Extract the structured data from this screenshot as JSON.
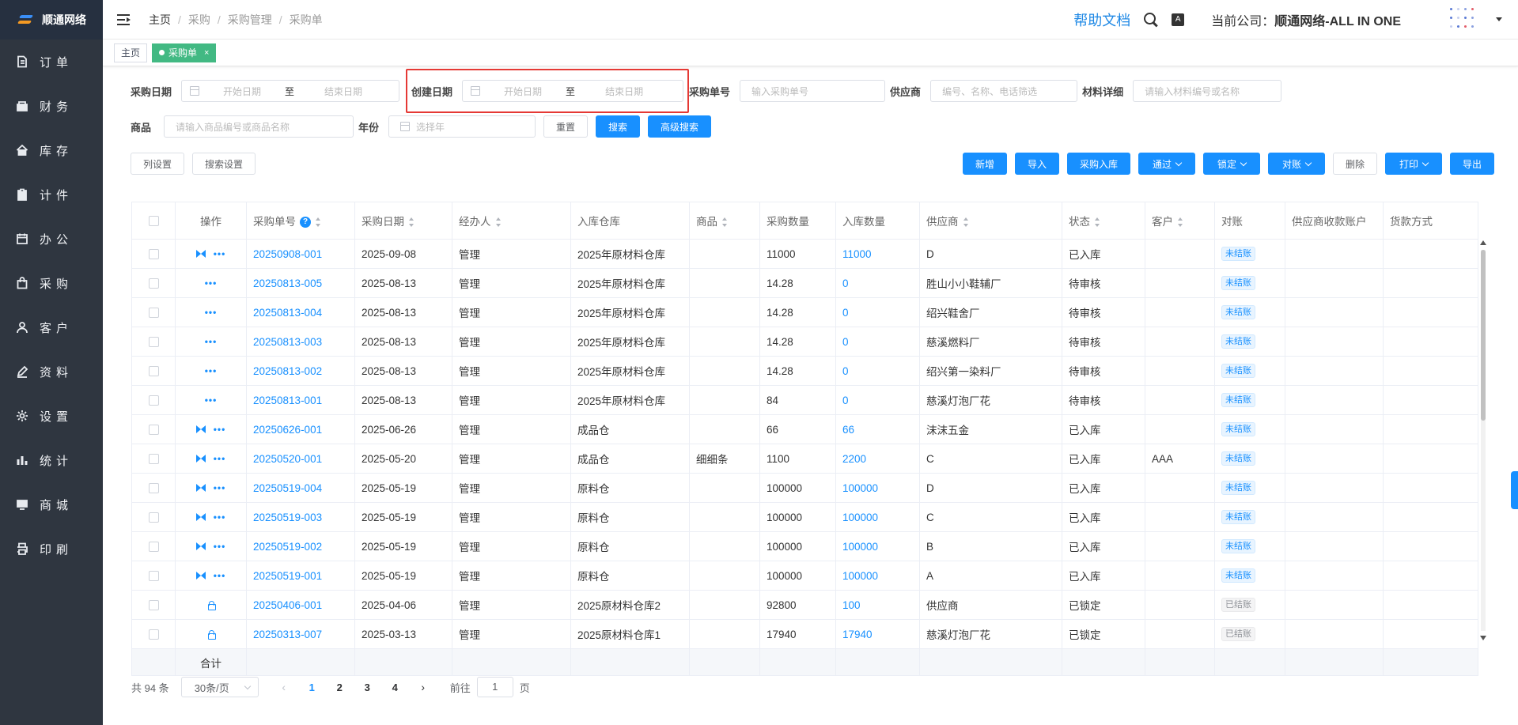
{
  "brand": {
    "name": "顺通网络"
  },
  "sidebar": {
    "items": [
      {
        "label": "订单",
        "icon": "order-icon"
      },
      {
        "label": "财务",
        "icon": "wallet-icon"
      },
      {
        "label": "库存",
        "icon": "home-icon"
      },
      {
        "label": "计件",
        "icon": "clipboard-icon"
      },
      {
        "label": "办公",
        "icon": "calendar-icon"
      },
      {
        "label": "采购",
        "icon": "bag-icon"
      },
      {
        "label": "客户",
        "icon": "user-icon"
      },
      {
        "label": "资料",
        "icon": "pen-icon"
      },
      {
        "label": "设置",
        "icon": "gear-icon"
      },
      {
        "label": "统计",
        "icon": "bar-chart-icon"
      },
      {
        "label": "商城",
        "icon": "shop-icon"
      },
      {
        "label": "印刷",
        "icon": "printer-icon"
      }
    ]
  },
  "header": {
    "breadcrumb": [
      "主页",
      "采购",
      "采购管理",
      "采购单"
    ],
    "help": "帮助文档",
    "font_icon_text": "A",
    "company_label": "当前公司：",
    "company_name": "顺通网络-ALL IN ONE"
  },
  "tags": {
    "home": "主页",
    "active": "采购单",
    "close": "×"
  },
  "filters": {
    "purchase_date_label": "采购日期",
    "create_date_label": "创建日期",
    "start_placeholder": "开始日期",
    "end_placeholder": "结束日期",
    "range_sep": "至",
    "order_no_label": "采购单号",
    "order_no_placeholder": "输入采购单号",
    "supplier_label": "供应商",
    "supplier_placeholder": "编号、名称、电话筛选",
    "material_label": "材料详细",
    "material_placeholder": "请输入材料编号或名称",
    "goods_label": "商品",
    "goods_placeholder": "请输入商品编号或商品名称",
    "year_label": "年份",
    "year_placeholder": "选择年",
    "reset": "重置",
    "search": "搜索",
    "advanced": "高级搜索"
  },
  "toolbar": {
    "col_settings": "列设置",
    "search_settings": "搜索设置",
    "add": "新增",
    "import": "导入",
    "stock_in": "采购入库",
    "approve": "通过",
    "lock": "锁定",
    "reconcile": "对账",
    "delete": "删除",
    "print": "打印",
    "export": "导出"
  },
  "table": {
    "headers": {
      "ops": "操作",
      "order_no": "采购单号",
      "date": "采购日期",
      "handler": "经办人",
      "warehouse": "入库仓库",
      "goods": "商品",
      "qty": "采购数量",
      "in_qty": "入库数量",
      "supplier": "供应商",
      "status": "状态",
      "customer": "客户",
      "reconcile": "对账",
      "account": "供应商收款账户",
      "payment": "货款方式"
    },
    "question_mark": "?",
    "rows": [
      {
        "order_no": "20250908-001",
        "date": "2025-09-08",
        "handler": "管理",
        "warehouse": "2025年原材料仓库",
        "goods": "",
        "qty": "11000",
        "in_qty": "11000",
        "supplier": "D",
        "status": "已入库",
        "customer": "",
        "reconcile": "未结账",
        "ops": "both"
      },
      {
        "order_no": "20250813-005",
        "date": "2025-08-13",
        "handler": "管理",
        "warehouse": "2025年原材料仓库",
        "goods": "",
        "qty": "14.28",
        "in_qty": "0",
        "supplier": "胜山小小鞋辅厂",
        "status": "待审核",
        "customer": "",
        "reconcile": "未结账",
        "ops": "more"
      },
      {
        "order_no": "20250813-004",
        "date": "2025-08-13",
        "handler": "管理",
        "warehouse": "2025年原材料仓库",
        "goods": "",
        "qty": "14.28",
        "in_qty": "0",
        "supplier": "绍兴鞋舍厂",
        "status": "待审核",
        "customer": "",
        "reconcile": "未结账",
        "ops": "more"
      },
      {
        "order_no": "20250813-003",
        "date": "2025-08-13",
        "handler": "管理",
        "warehouse": "2025年原材料仓库",
        "goods": "",
        "qty": "14.28",
        "in_qty": "0",
        "supplier": "慈溪燃料厂",
        "status": "待审核",
        "customer": "",
        "reconcile": "未结账",
        "ops": "more"
      },
      {
        "order_no": "20250813-002",
        "date": "2025-08-13",
        "handler": "管理",
        "warehouse": "2025年原材料仓库",
        "goods": "",
        "qty": "14.28",
        "in_qty": "0",
        "supplier": "绍兴第一染料厂",
        "status": "待审核",
        "customer": "",
        "reconcile": "未结账",
        "ops": "more"
      },
      {
        "order_no": "20250813-001",
        "date": "2025-08-13",
        "handler": "管理",
        "warehouse": "2025年原材料仓库",
        "goods": "",
        "qty": "84",
        "in_qty": "0",
        "supplier": "慈溪灯泡厂花",
        "status": "待审核",
        "customer": "",
        "reconcile": "未结账",
        "ops": "more"
      },
      {
        "order_no": "20250626-001",
        "date": "2025-06-26",
        "handler": "管理",
        "warehouse": "成品仓",
        "goods": "",
        "qty": "66",
        "in_qty": "66",
        "supplier": "沫沫五金",
        "status": "已入库",
        "customer": "",
        "reconcile": "未结账",
        "ops": "both"
      },
      {
        "order_no": "20250520-001",
        "date": "2025-05-20",
        "handler": "管理",
        "warehouse": "成品仓",
        "goods": "细细条",
        "qty": "1100",
        "in_qty": "2200",
        "supplier": "C",
        "status": "已入库",
        "customer": "AAA",
        "reconcile": "未结账",
        "ops": "both"
      },
      {
        "order_no": "20250519-004",
        "date": "2025-05-19",
        "handler": "管理",
        "warehouse": "原料仓",
        "goods": "",
        "qty": "100000",
        "in_qty": "100000",
        "supplier": "D",
        "status": "已入库",
        "customer": "",
        "reconcile": "未结账",
        "ops": "both"
      },
      {
        "order_no": "20250519-003",
        "date": "2025-05-19",
        "handler": "管理",
        "warehouse": "原料仓",
        "goods": "",
        "qty": "100000",
        "in_qty": "100000",
        "supplier": "C",
        "status": "已入库",
        "customer": "",
        "reconcile": "未结账",
        "ops": "both"
      },
      {
        "order_no": "20250519-002",
        "date": "2025-05-19",
        "handler": "管理",
        "warehouse": "原料仓",
        "goods": "",
        "qty": "100000",
        "in_qty": "100000",
        "supplier": "B",
        "status": "已入库",
        "customer": "",
        "reconcile": "未结账",
        "ops": "both"
      },
      {
        "order_no": "20250519-001",
        "date": "2025-05-19",
        "handler": "管理",
        "warehouse": "原料仓",
        "goods": "",
        "qty": "100000",
        "in_qty": "100000",
        "supplier": "A",
        "status": "已入库",
        "customer": "",
        "reconcile": "未结账",
        "ops": "both"
      },
      {
        "order_no": "20250406-001",
        "date": "2025-04-06",
        "handler": "管理",
        "warehouse": "2025原材料仓库2",
        "goods": "",
        "qty": "92800",
        "in_qty": "100",
        "supplier": "供应商",
        "status": "已锁定",
        "customer": "",
        "reconcile": "已结账",
        "ops": "lock"
      },
      {
        "order_no": "20250313-007",
        "date": "2025-03-13",
        "handler": "管理",
        "warehouse": "2025原材料仓库1",
        "goods": "",
        "qty": "17940",
        "in_qty": "17940",
        "supplier": "慈溪灯泡厂花",
        "status": "已锁定",
        "customer": "",
        "reconcile": "已结账",
        "ops": "lock"
      }
    ],
    "sum_label": "合计"
  },
  "pagination": {
    "total": "共 94 条",
    "page_size": "30条/页",
    "prev": "‹",
    "next": "›",
    "pages": [
      "1",
      "2",
      "3",
      "4"
    ],
    "current": "1",
    "goto_label": "前往",
    "goto_value": "1",
    "page_unit": "页"
  },
  "colors": {
    "primary": "#1890ff",
    "sidebar": "#2f3640",
    "tag_active": "#42b983",
    "highlight": "#e53935"
  }
}
